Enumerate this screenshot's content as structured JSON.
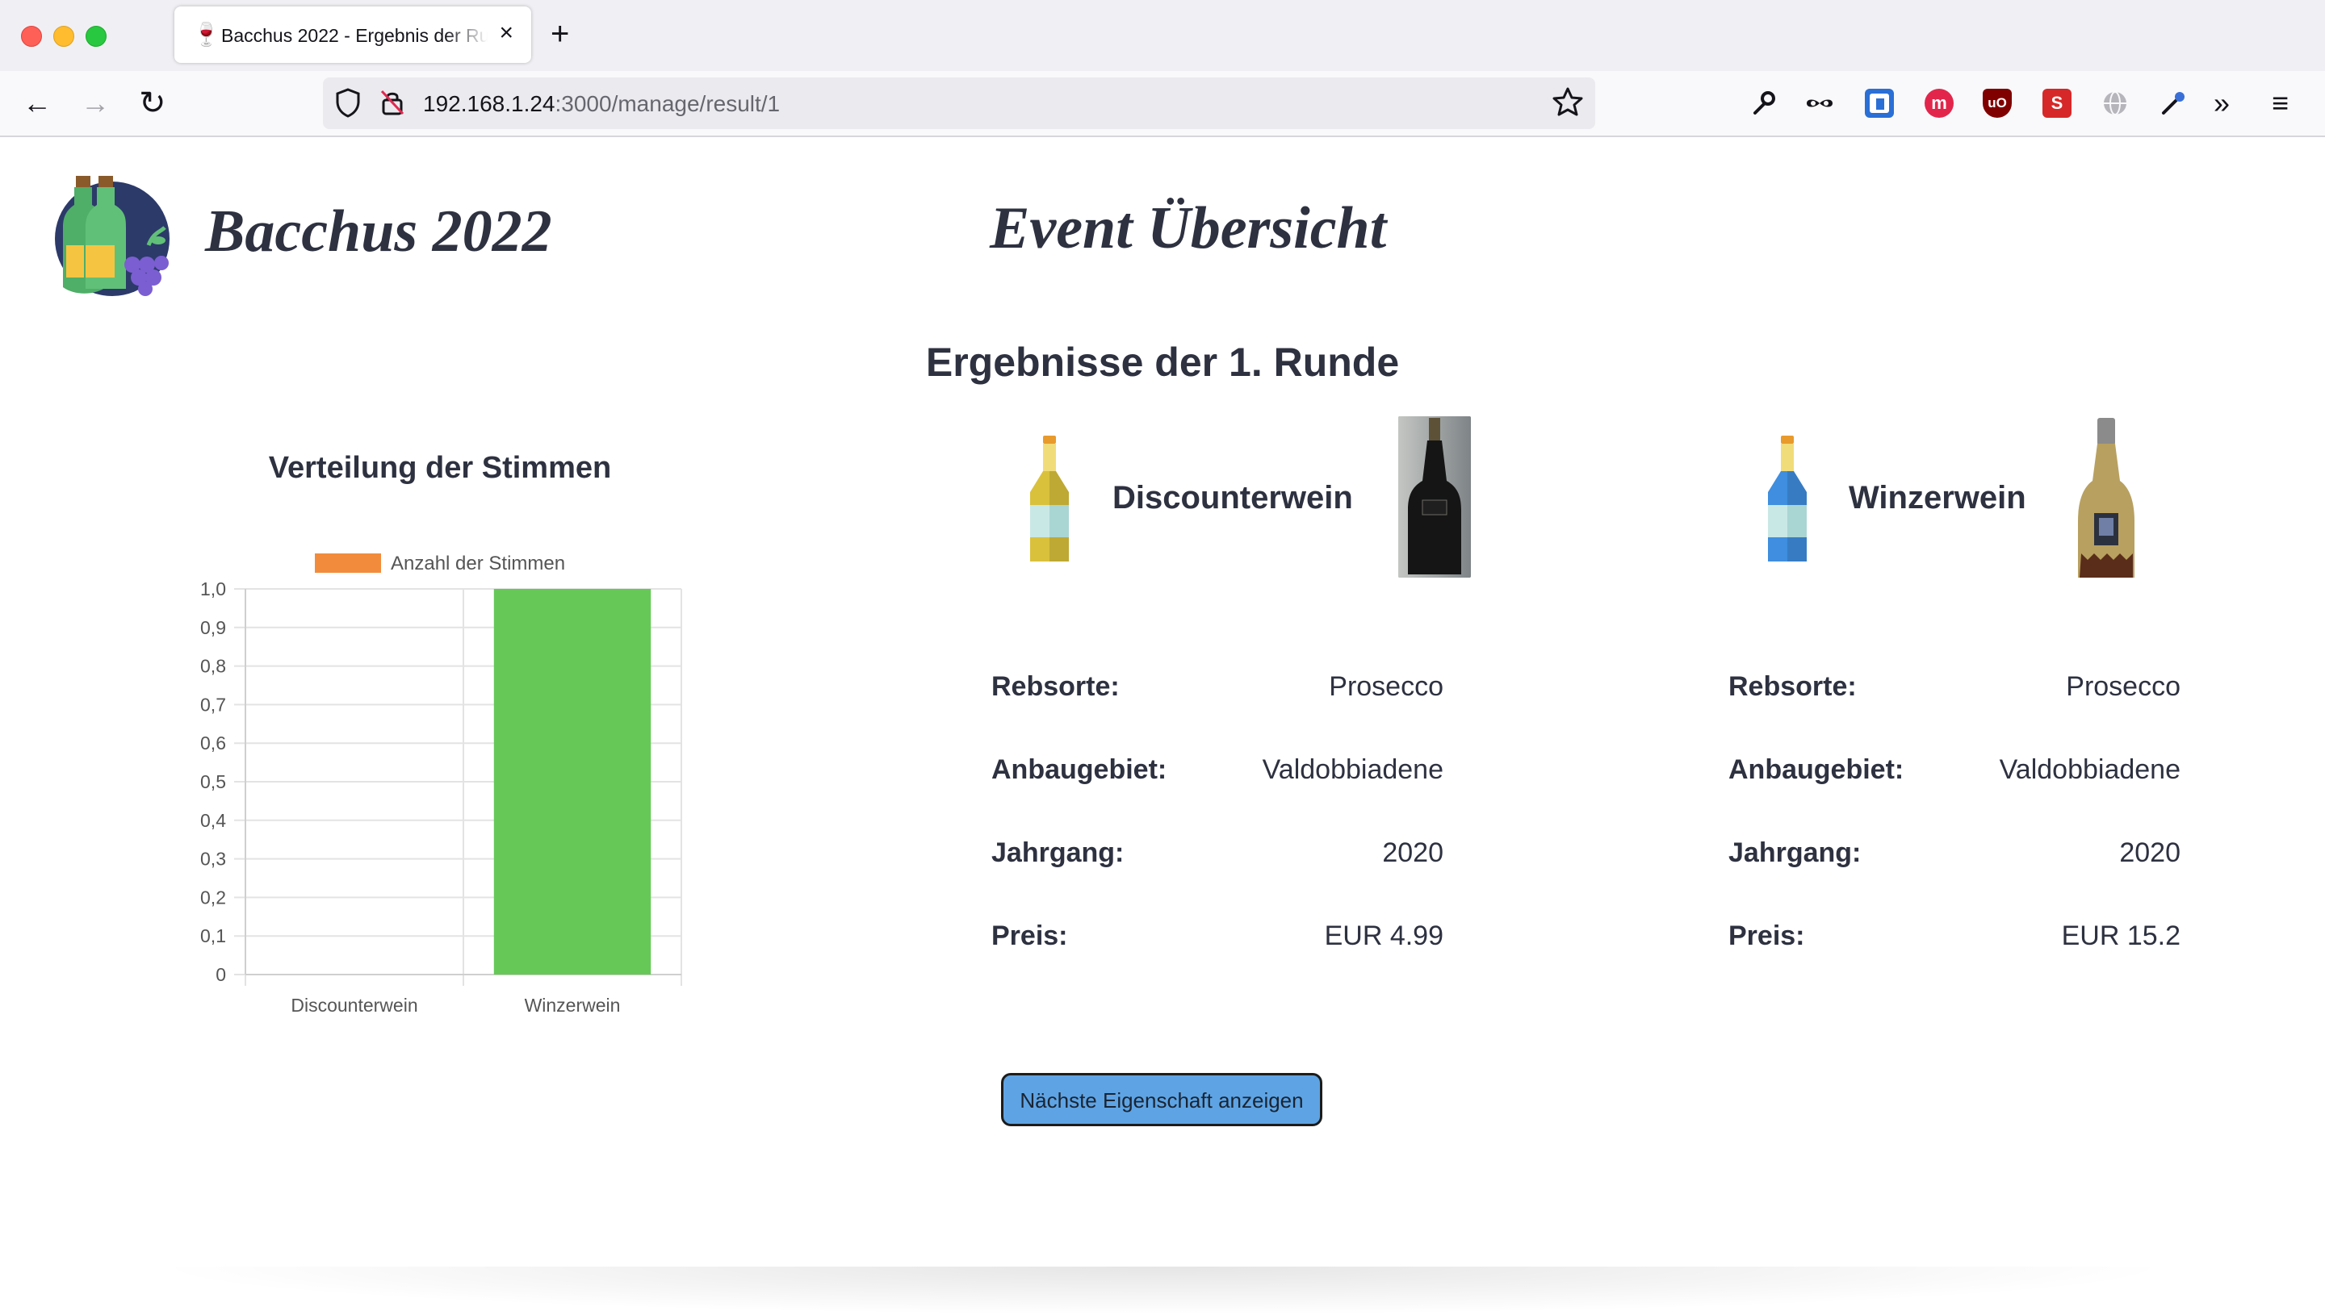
{
  "browser": {
    "tab_title": "Bacchus 2022 - Ergebnis der Runde",
    "url_host": "192.168.1.24",
    "url_path": ":3000/manage/result/1"
  },
  "header": {
    "site_title": "Bacchus 2022",
    "event_title": "Event Übersicht"
  },
  "main": {
    "round_title": "Ergebnisse der 1. Runde",
    "next_button_label": "Nächste Eigenschaft anzeigen"
  },
  "wines": [
    {
      "name": "Discounterwein",
      "bottle_color": "#d9c13c",
      "props": [
        {
          "label": "Rebsorte:",
          "value": "Prosecco"
        },
        {
          "label": "Anbaugebiet:",
          "value": "Valdobbiadene"
        },
        {
          "label": "Jahrgang:",
          "value": "2020"
        },
        {
          "label": "Preis:",
          "value": "EUR 4.99"
        }
      ]
    },
    {
      "name": "Winzerwein",
      "bottle_color": "#3f8edf",
      "props": [
        {
          "label": "Rebsorte:",
          "value": "Prosecco"
        },
        {
          "label": "Anbaugebiet:",
          "value": "Valdobbiadene"
        },
        {
          "label": "Jahrgang:",
          "value": "2020"
        },
        {
          "label": "Preis:",
          "value": "EUR 15.2"
        }
      ]
    }
  ],
  "chart_data": {
    "type": "bar",
    "title": "Verteilung der Stimmen",
    "categories": [
      "Discounterwein",
      "Winzerwein"
    ],
    "series": [
      {
        "name": "Anzahl der Stimmen",
        "values": [
          0,
          1
        ]
      }
    ],
    "legend_color": "#f28c3c",
    "bar_colors": [
      "#f28c3c",
      "#66c957"
    ],
    "ylim": [
      0,
      1
    ],
    "yticks": [
      "0",
      "0,1",
      "0,2",
      "0,3",
      "0,4",
      "0,5",
      "0,6",
      "0,7",
      "0,8",
      "0,9",
      "1,0"
    ],
    "grid": true,
    "legend_position": "top"
  }
}
